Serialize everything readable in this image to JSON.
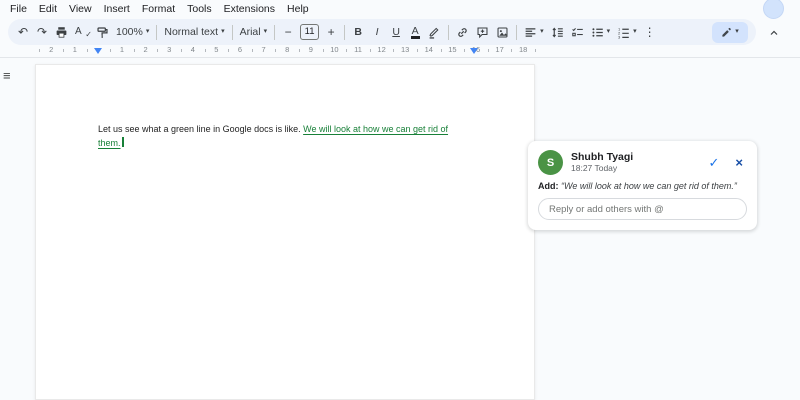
{
  "menu": {
    "items": [
      "File",
      "Edit",
      "View",
      "Insert",
      "Format",
      "Tools",
      "Extensions",
      "Help"
    ]
  },
  "toolbar": {
    "zoom_value": "100%",
    "style_value": "Normal text",
    "font_value": "Arial",
    "font_size_value": "11",
    "bold_label": "B",
    "italic_label": "I",
    "underline_label": "U",
    "text_color_label": "A",
    "spellcheck_label": "A"
  },
  "icons": {
    "undo": "↶",
    "redo": "↷",
    "dropdown": "▾",
    "minus": "−",
    "plus": "+",
    "more_vertical": "⋮",
    "check": "✓",
    "close": "×",
    "outline": "≡",
    "spellcheck_check": "✓"
  },
  "ruler": {
    "margin_numbers": [
      "2",
      "1"
    ],
    "content_numbers": [
      "1",
      "2",
      "3",
      "4",
      "5",
      "6",
      "7",
      "8",
      "9",
      "10",
      "11",
      "12",
      "13",
      "14",
      "15",
      "16",
      "17",
      "18"
    ]
  },
  "document": {
    "line1_normal": "Let us see what a green line in Google docs is like. ",
    "line1_suggested": "We will look at how we can get rid of",
    "line2_suggested": "them."
  },
  "comment": {
    "avatar_initial": "S",
    "author": "Shubh Tyagi",
    "timestamp": "18:27 Today",
    "action_label": "Add:",
    "quote": "“We will look at how we can get rid of them.”",
    "reply_placeholder": "Reply or add others with @"
  },
  "colors": {
    "canvas_bg": "#f9fbfd",
    "toolbar_bg": "#edf2fa",
    "suggestion_green": "#188038",
    "accent_blue": "#1a73e8",
    "avatar_green": "#4a9345",
    "marker_blue": "#4285f4"
  }
}
